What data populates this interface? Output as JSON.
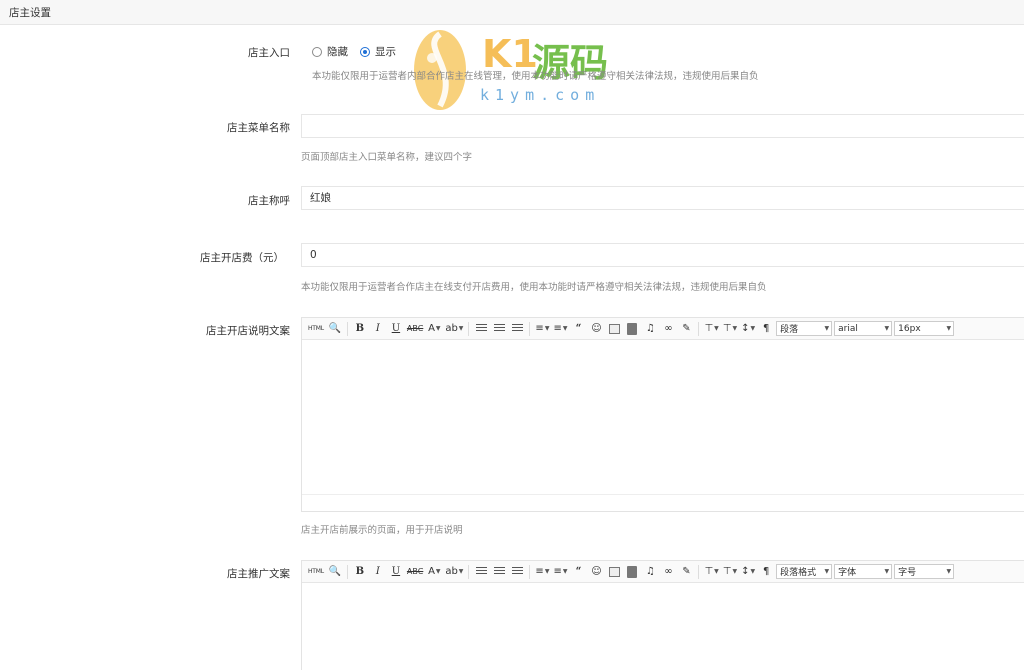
{
  "page": {
    "title": "店主设置"
  },
  "entry": {
    "label": "店主入口",
    "options": [
      {
        "label": "隐藏",
        "checked": false
      },
      {
        "label": "显示",
        "checked": true
      }
    ],
    "hint": "本功能仅限用于运营者内部合作店主在线管理，使用本功能时请严格遵守相关法律法规，违规使用后果自负"
  },
  "menu_name": {
    "label": "店主菜单名称",
    "value": "",
    "hint": "页面顶部店主入口菜单名称，建议四个字"
  },
  "title_field": {
    "label": "店主称呼",
    "value": "红娘"
  },
  "fee": {
    "label": "店主开店费（元）",
    "value": "0",
    "hint": "本功能仅限用于运营者合作店主在线支付开店费用，使用本功能时请严格遵守相关法律法规，违规使用后果自负"
  },
  "open_desc": {
    "label": "店主开店说明文案",
    "hint": "店主开店前展示的页面，用于开店说明",
    "toolbar": {
      "html": "HTML",
      "paragraph": "段落",
      "font": "arial",
      "size": "16px"
    }
  },
  "promo": {
    "label": "店主推广文案",
    "toolbar": {
      "html": "HTML",
      "paragraph": "段落格式",
      "font": "字体",
      "size": "字号"
    }
  },
  "watermark": {
    "brand": "K1",
    "brand_cn": "源码",
    "url": "k1ym.com"
  },
  "icons": [
    "html-icon",
    "preview-icon",
    "bold-icon",
    "italic-icon",
    "underline-icon",
    "strikethrough-icon",
    "font-color-icon",
    "highlight-icon",
    "align-left-icon",
    "align-center-icon",
    "align-right-icon",
    "ordered-list-icon",
    "unordered-list-icon",
    "quote-icon",
    "emoji-icon",
    "image-icon",
    "video-icon",
    "music-icon",
    "link-icon",
    "eraser-icon",
    "row-spacing-icon",
    "paragraph-spacing-icon",
    "line-height-icon",
    "format-icon"
  ]
}
